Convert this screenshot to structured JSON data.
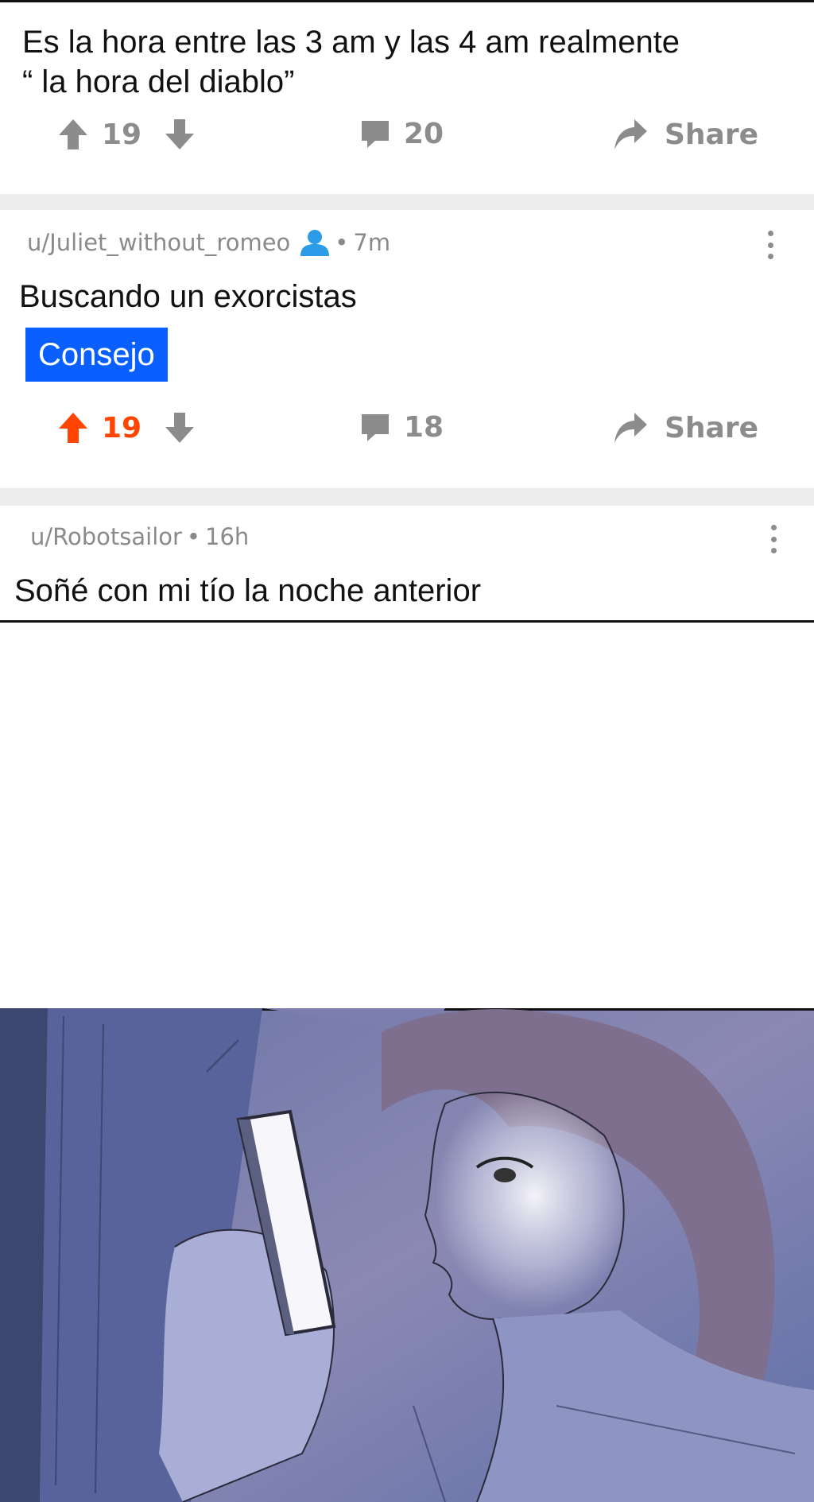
{
  "post1": {
    "title": "Es la hora entre las 3 am y las 4 am realmente\n“ la hora del diablo”",
    "votes": "19",
    "comments": "20",
    "share_label": "Share"
  },
  "post2": {
    "username": "u/Juliet_without_romeo",
    "time": "7m",
    "title": "Buscando un exorcistas",
    "flair": "Consejo",
    "votes": "19",
    "comments": "18",
    "share_label": "Share",
    "upvoted_color": "#ff4500"
  },
  "post3": {
    "username": "u/Robotsailor",
    "time": "16h",
    "title": "Soñé con mi tío la noche anterior"
  },
  "colors": {
    "flair_bg": "#0a5fff",
    "icon_gray": "#8c8c8c",
    "upvote_active": "#ff4500",
    "user_icon": "#2d9ce8"
  }
}
